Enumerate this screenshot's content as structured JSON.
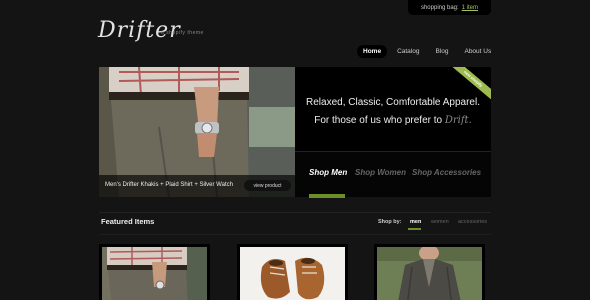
{
  "header": {
    "bag_label": "shopping bag:",
    "bag_link": "1 item",
    "logo": "Drifter",
    "tagline": "a shopify theme"
  },
  "nav": {
    "items": [
      {
        "label": "Home",
        "active": true
      },
      {
        "label": "Catalog",
        "active": false
      },
      {
        "label": "Blog",
        "active": false
      },
      {
        "label": "About Us",
        "active": false
      }
    ]
  },
  "hero": {
    "caption": "Men's Drifter Khakis + Plaid Shirt + Silver Watch",
    "view_button": "view product",
    "line1": "Relaxed, Classic, Comfortable Apparel.",
    "line2_prefix": "For those of us who prefer to",
    "line2_accent": "Drift.",
    "ribbon": "new shopify",
    "tabs": [
      {
        "label": "Shop Men",
        "active": true
      },
      {
        "label": "Shop Women",
        "active": false
      },
      {
        "label": "Shop Accessories",
        "active": false
      }
    ]
  },
  "featured": {
    "title": "Featured Items",
    "shop_by": "Shop by:",
    "filters": [
      {
        "label": "men",
        "active": true
      },
      {
        "label": "women",
        "active": false
      },
      {
        "label": "accessories",
        "active": false
      }
    ]
  },
  "colors": {
    "accent_green": "#6c8f2a",
    "link_green": "#a6c35a",
    "background": "#141414"
  }
}
